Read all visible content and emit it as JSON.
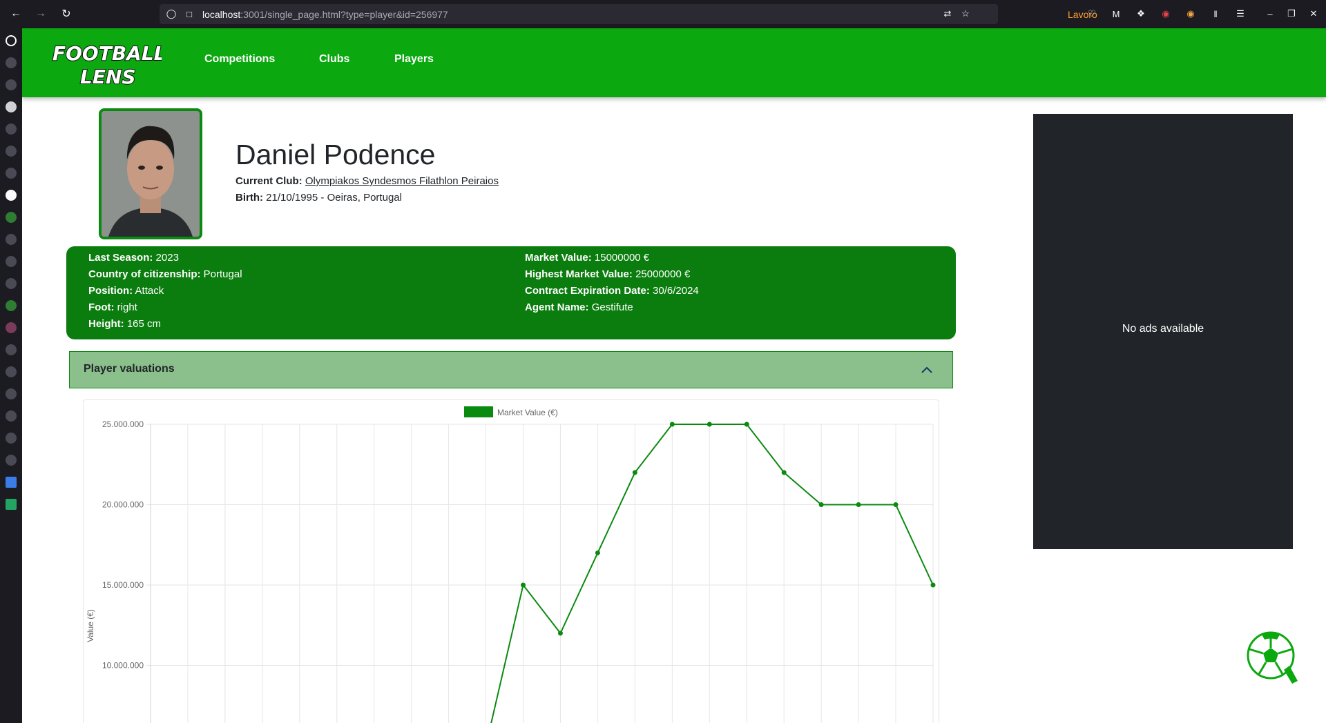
{
  "browser": {
    "url_host": "localhost",
    "url_path": ":3001/single_page.html?type=player&id=256977",
    "container_label": "Lavoro",
    "accent": "#1c1b22"
  },
  "app": {
    "logo_text_top": "FOOTBALL",
    "logo_text_bottom": "LENS",
    "nav": {
      "competitions": "Competitions",
      "clubs": "Clubs",
      "players": "Players"
    },
    "brand_color": "#0ba80f"
  },
  "player": {
    "name": "Daniel Podence",
    "current_club_label": "Current Club:",
    "current_club": "Olympiakos Syndesmos Filathlon Peiraios",
    "birth_label": "Birth:",
    "birth": "21/10/1995 - Oeiras, Portugal"
  },
  "stats": {
    "left": [
      {
        "label": "Last Season:",
        "value": "2023"
      },
      {
        "label": "Country of citizenship:",
        "value": "Portugal"
      },
      {
        "label": "Position:",
        "value": "Attack"
      },
      {
        "label": "Foot:",
        "value": "right"
      },
      {
        "label": "Height:",
        "value": "165 cm"
      }
    ],
    "right": [
      {
        "label": "Market Value:",
        "value": "15000000 €"
      },
      {
        "label": "Highest Market Value:",
        "value": "25000000 €"
      },
      {
        "label": "Contract Expiration Date:",
        "value": "30/6/2024"
      },
      {
        "label": "Agent Name:",
        "value": "Gestifute"
      }
    ]
  },
  "accordion": {
    "title": "Player valuations"
  },
  "chart_data": {
    "type": "line",
    "legend": "Market Value (€)",
    "ylabel": "Value (€)",
    "color": "#0b8a10",
    "ylim": [
      7000000,
      25000000
    ],
    "yticks": [
      {
        "value": 25000000,
        "label": "25.000.000"
      },
      {
        "value": 20000000,
        "label": "20.000.000"
      },
      {
        "value": 15000000,
        "label": "15.000.000"
      },
      {
        "value": 10000000,
        "label": "10.000.000"
      }
    ],
    "values": [
      null,
      null,
      null,
      null,
      null,
      null,
      null,
      null,
      null,
      null,
      15000000,
      12000000,
      17000000,
      22000000,
      25000000,
      25000000,
      25000000,
      22000000,
      20000000,
      20000000,
      20000000,
      15000000
    ],
    "lead_in": 5000000
  },
  "ads": {
    "text": "No ads available"
  }
}
